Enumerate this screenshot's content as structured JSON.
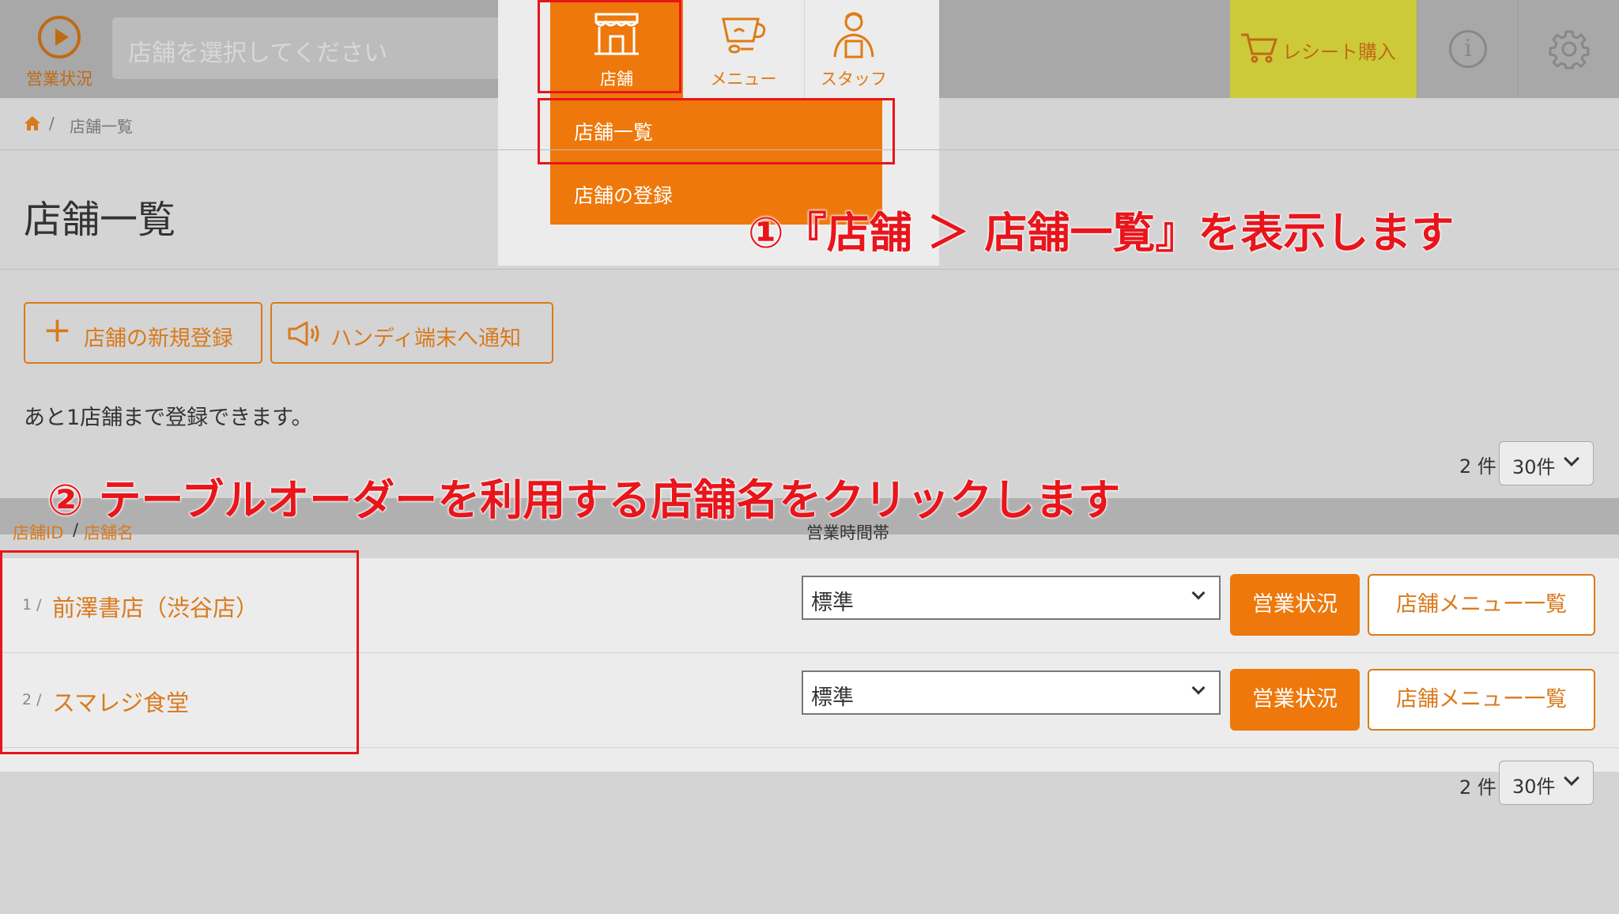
{
  "header": {
    "status_label": "営業状況",
    "store_select_placeholder": "店舗を選択してください",
    "nav": {
      "store": "店舗",
      "menu": "メニュー",
      "staff": "スタッフ"
    },
    "dropdown": {
      "store_list": "店舗一覧",
      "store_register": "店舗の登録"
    },
    "receipt_button": "レシート購入",
    "info_icon": "info-icon",
    "gear_icon": "gear-icon"
  },
  "breadcrumb": {
    "separator": "/",
    "current": "店舗一覧"
  },
  "page": {
    "title": "店舗一覧",
    "new_store_button": "店舗の新規登録",
    "notify_button": "ハンディ端末へ通知",
    "remaining_text": "あと1店舗まで登録できます。"
  },
  "pagination": {
    "count": "2 件",
    "per_page": "30件"
  },
  "table": {
    "headers": {
      "store_id": "店舗ID",
      "slash": "/",
      "store_name": "店舗名",
      "hours": "営業時間帯"
    },
    "rows": [
      {
        "num": "1 /",
        "name": "前澤書店（渋谷店）",
        "hours": "標準",
        "status_button": "営業状況",
        "menu_button": "店舗メニュー一覧"
      },
      {
        "num": "2 /",
        "name": "スマレジ食堂",
        "hours": "標準",
        "status_button": "営業状況",
        "menu_button": "店舗メニュー一覧"
      }
    ]
  },
  "annotations": {
    "step1": "①『店舗 ＞ 店舗一覧』を表示します",
    "step2": "② テーブルオーダーを利用する店舗名をクリックします"
  },
  "colors": {
    "accent": "#ee780b",
    "annotation": "#e8151b",
    "receipt": "#cdca3a"
  }
}
